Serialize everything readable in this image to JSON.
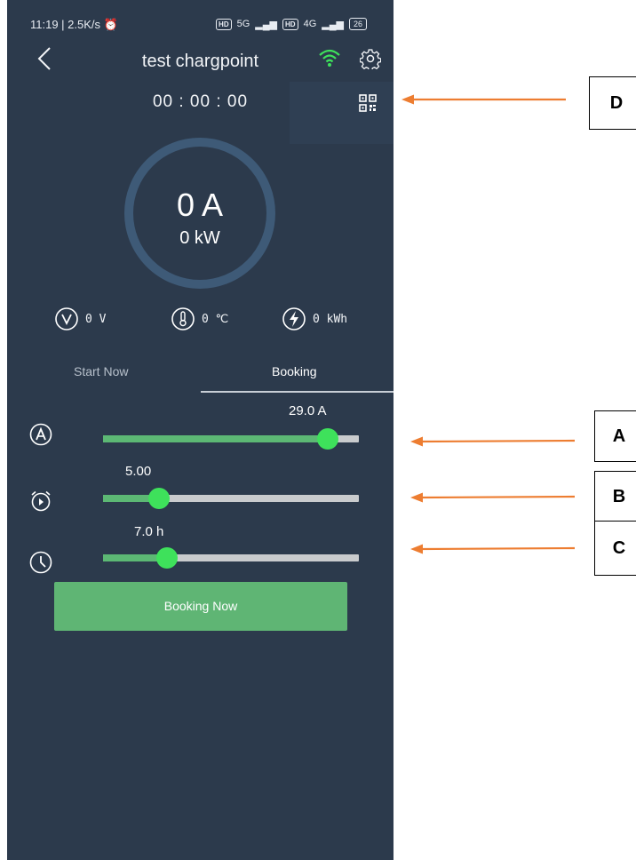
{
  "status_bar": {
    "left_text": "11:19 | 2.5K/s",
    "net1": "5G",
    "net2": "4G",
    "hd": "HD",
    "battery": "26"
  },
  "header": {
    "title": "test chargpoint",
    "wifi_color": "#3ee15b"
  },
  "timer": "00 : 00 : 00",
  "gauge": {
    "current": "0 A",
    "power": "0 kW"
  },
  "stats": {
    "voltage": "0 V",
    "temperature": "0 ℃",
    "energy": "0 kWh"
  },
  "tabs": {
    "start_now": "Start Now",
    "booking": "Booking",
    "active": "Booking"
  },
  "sliders": {
    "current": {
      "label": "29.0 A",
      "fraction": 0.88
    },
    "start_delay": {
      "label": "5.00",
      "fraction": 0.22
    },
    "duration": {
      "label": "7.0 h",
      "fraction": 0.25
    }
  },
  "booking_button": "Booking Now",
  "annotations": {
    "a": "A",
    "b": "B",
    "c": "C",
    "d": "D",
    "arrow_color": "#ed7d31"
  },
  "colors": {
    "background": "#2c3a4c",
    "accent_green": "#3ee15b",
    "track_fill": "#5cb874",
    "button": "#5fb574"
  }
}
